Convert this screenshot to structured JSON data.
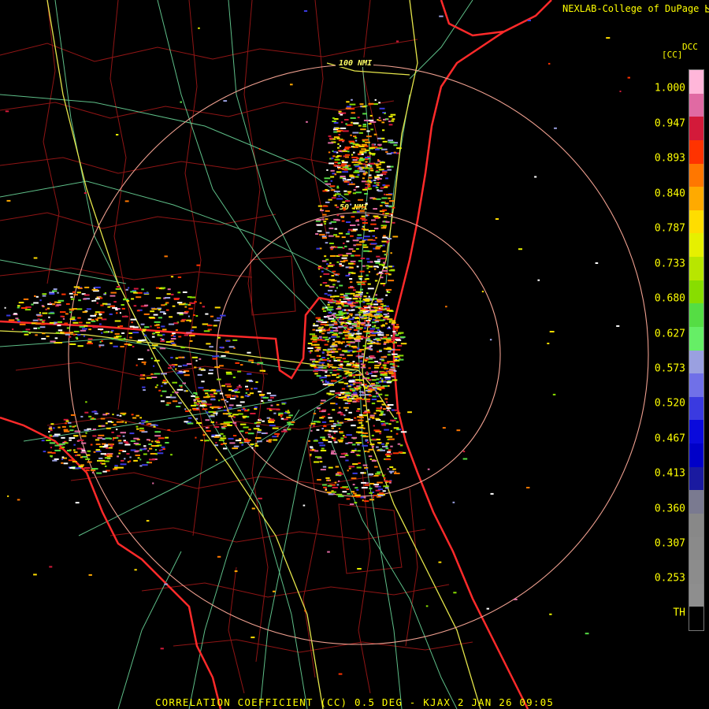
{
  "header": {
    "credit": "NEXLAB-College of DuPage",
    "credit_icon": "diagonal-arrow-icon"
  },
  "product": {
    "code": "DCC",
    "unit": "[CC]"
  },
  "range_rings": [
    "50 NMI",
    "100 NMI"
  ],
  "legend": {
    "labels": [
      "1.000",
      "0.947",
      "0.893",
      "0.840",
      "0.787",
      "0.733",
      "0.680",
      "0.627",
      "0.573",
      "0.520",
      "0.467",
      "0.413",
      "0.360",
      "0.307",
      "0.253",
      "TH"
    ],
    "colors": [
      "#ffb6d9",
      "#e06aa3",
      "#d31a3a",
      "#ff3300",
      "#ff7700",
      "#ffaa00",
      "#ffdd00",
      "#e6f000",
      "#b8e600",
      "#88dd00",
      "#55dd44",
      "#66ee66",
      "#9aa0e0",
      "#7070e8",
      "#3a3ae0",
      "#0a0adc",
      "#0000c8",
      "#1a1aa0",
      "#7a7a90",
      "#888888",
      "#8a8a8a",
      "#8c8c8c",
      "#8e8e8e",
      "#000000"
    ]
  },
  "footer": {
    "caption": "CORRELATION COEFFICIENT (CC) 0.5 DEG - KJAX 2 JAN 26 09:05"
  },
  "colors": {
    "label_yellow": "#ffff00",
    "boundary_red": "#ff2a2a",
    "road_green": "#6fe0a0",
    "highway_yellow": "#e6e64a",
    "ring_salmon": "#f0a090"
  }
}
